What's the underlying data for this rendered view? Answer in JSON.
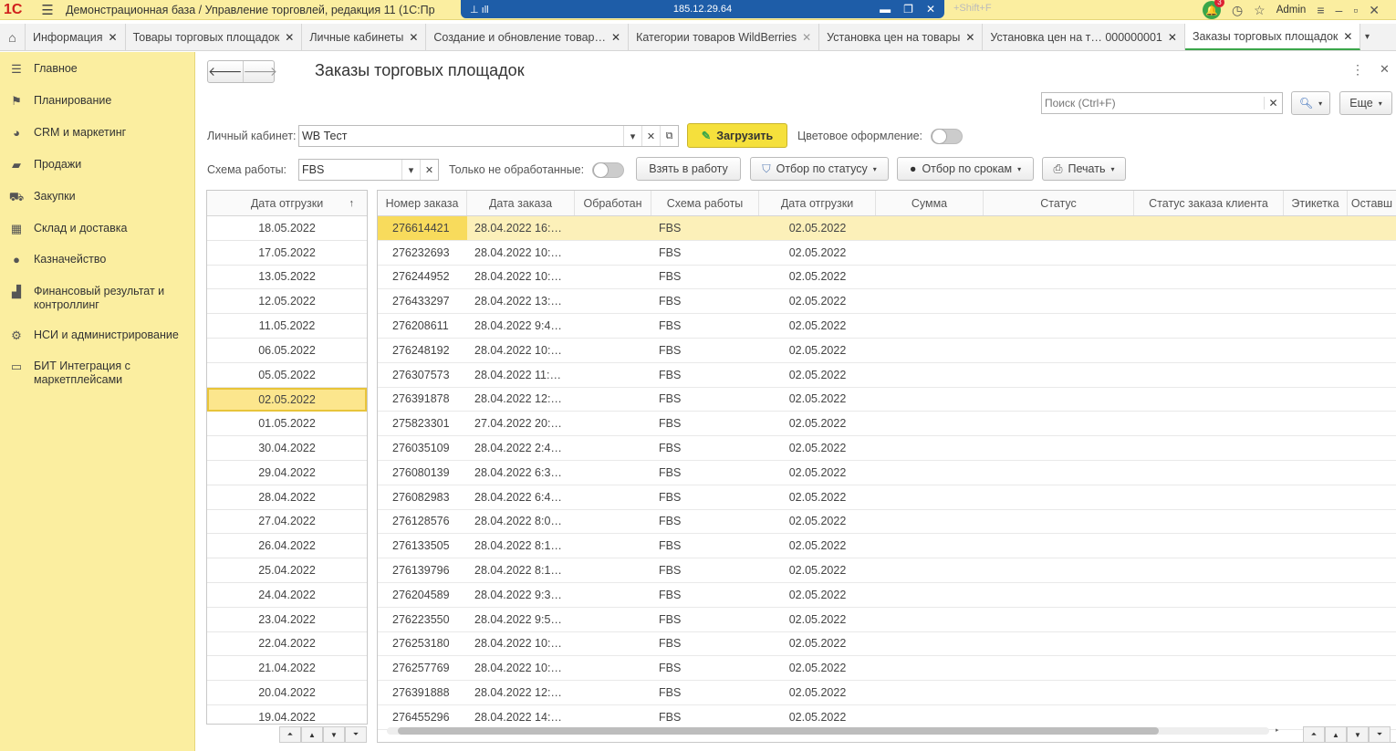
{
  "titlebar": {
    "logo": "1С",
    "title": "Демонстрационная база / Управление торговлей, редакция 11  (1С:Пр",
    "remote_ip": "185.12.29.64",
    "shift_hint": "+Shift+F",
    "notifications": "3",
    "user": "Admin"
  },
  "tabs": [
    {
      "label": "Информация"
    },
    {
      "label": "Товары торговых площадок"
    },
    {
      "label": "Личные кабинеты"
    },
    {
      "label": "Создание и обновление товар…"
    },
    {
      "label": "Категории товаров WildBerries"
    },
    {
      "label": "Установка цен на товары"
    },
    {
      "label": "Установка цен на т… 000000001"
    },
    {
      "label": "Заказы торговых площадок"
    }
  ],
  "sidebar": {
    "items": [
      {
        "label": "Главное",
        "icon": "menu-lines-icon"
      },
      {
        "label": "Планирование",
        "icon": "planning-icon"
      },
      {
        "label": "CRM и маркетинг",
        "icon": "pie-chart-icon"
      },
      {
        "label": "Продажи",
        "icon": "briefcase-icon"
      },
      {
        "label": "Закупки",
        "icon": "cart-icon"
      },
      {
        "label": "Склад и доставка",
        "icon": "grid-icon"
      },
      {
        "label": "Казначейство",
        "icon": "coin-icon"
      },
      {
        "label": "Финансовый результат и контроллинг",
        "icon": "bar-chart-icon"
      },
      {
        "label": "НСИ и администрирование",
        "icon": "gear-icon"
      },
      {
        "label": "БИТ Интеграция с маркетплейсами",
        "icon": "chat-icon"
      }
    ]
  },
  "header": {
    "title": "Заказы торговых площадок",
    "search_placeholder": "Поиск (Ctrl+F)",
    "more_label": "Еще"
  },
  "form": {
    "cabinet_label": "Личный кабинет:",
    "cabinet_value": "WB Тест",
    "load_label": "Загрузить",
    "color_label": "Цветовое оформление:",
    "scheme_label": "Схема работы:",
    "scheme_value": "FBS",
    "unprocessed_label": "Только не обработанные:",
    "take_label": "Взять в работу",
    "status_filter_label": "Отбор по статусу",
    "deadline_filter_label": "Отбор по срокам",
    "print_label": "Печать"
  },
  "dates_table": {
    "header": "Дата отгрузки",
    "selected": "02.05.2022",
    "rows": [
      "18.05.2022",
      "17.05.2022",
      "13.05.2022",
      "12.05.2022",
      "11.05.2022",
      "06.05.2022",
      "05.05.2022",
      "02.05.2022",
      "01.05.2022",
      "30.04.2022",
      "29.04.2022",
      "28.04.2022",
      "27.04.2022",
      "26.04.2022",
      "25.04.2022",
      "24.04.2022",
      "23.04.2022",
      "22.04.2022",
      "21.04.2022",
      "20.04.2022",
      "19.04.2022"
    ]
  },
  "orders_table": {
    "columns": [
      "Номер заказа",
      "Дата заказа",
      "Обработан",
      "Схема работы",
      "Дата отгрузки",
      "Сумма",
      "Статус",
      "Статус заказа клиента",
      "Этикетка",
      "Оставш"
    ],
    "rows": [
      [
        "276614421",
        "28.04.2022 16:…",
        "",
        "FBS",
        "02.05.2022"
      ],
      [
        "276232693",
        "28.04.2022 10:…",
        "",
        "FBS",
        "02.05.2022"
      ],
      [
        "276244952",
        "28.04.2022 10:…",
        "",
        "FBS",
        "02.05.2022"
      ],
      [
        "276433297",
        "28.04.2022 13:…",
        "",
        "FBS",
        "02.05.2022"
      ],
      [
        "276208611",
        "28.04.2022 9:4…",
        "",
        "FBS",
        "02.05.2022"
      ],
      [
        "276248192",
        "28.04.2022 10:…",
        "",
        "FBS",
        "02.05.2022"
      ],
      [
        "276307573",
        "28.04.2022 11:…",
        "",
        "FBS",
        "02.05.2022"
      ],
      [
        "276391878",
        "28.04.2022 12:…",
        "",
        "FBS",
        "02.05.2022"
      ],
      [
        "275823301",
        "27.04.2022 20:…",
        "",
        "FBS",
        "02.05.2022"
      ],
      [
        "276035109",
        "28.04.2022 2:4…",
        "",
        "FBS",
        "02.05.2022"
      ],
      [
        "276080139",
        "28.04.2022 6:3…",
        "",
        "FBS",
        "02.05.2022"
      ],
      [
        "276082983",
        "28.04.2022 6:4…",
        "",
        "FBS",
        "02.05.2022"
      ],
      [
        "276128576",
        "28.04.2022 8:0…",
        "",
        "FBS",
        "02.05.2022"
      ],
      [
        "276133505",
        "28.04.2022 8:1…",
        "",
        "FBS",
        "02.05.2022"
      ],
      [
        "276139796",
        "28.04.2022 8:1…",
        "",
        "FBS",
        "02.05.2022"
      ],
      [
        "276204589",
        "28.04.2022 9:3…",
        "",
        "FBS",
        "02.05.2022"
      ],
      [
        "276223550",
        "28.04.2022 9:5…",
        "",
        "FBS",
        "02.05.2022"
      ],
      [
        "276253180",
        "28.04.2022 10:…",
        "",
        "FBS",
        "02.05.2022"
      ],
      [
        "276257769",
        "28.04.2022 10:…",
        "",
        "FBS",
        "02.05.2022"
      ],
      [
        "276391888",
        "28.04.2022 12:…",
        "",
        "FBS",
        "02.05.2022"
      ],
      [
        "276455296",
        "28.04.2022 14:…",
        "",
        "FBS",
        "02.05.2022"
      ]
    ]
  },
  "colors": {
    "sidebar_bg": "#fbeea0",
    "accent_yellow": "#f5e03c",
    "selected_row": "#fcf0b9",
    "active_tab_underline": "#3aa64a"
  }
}
